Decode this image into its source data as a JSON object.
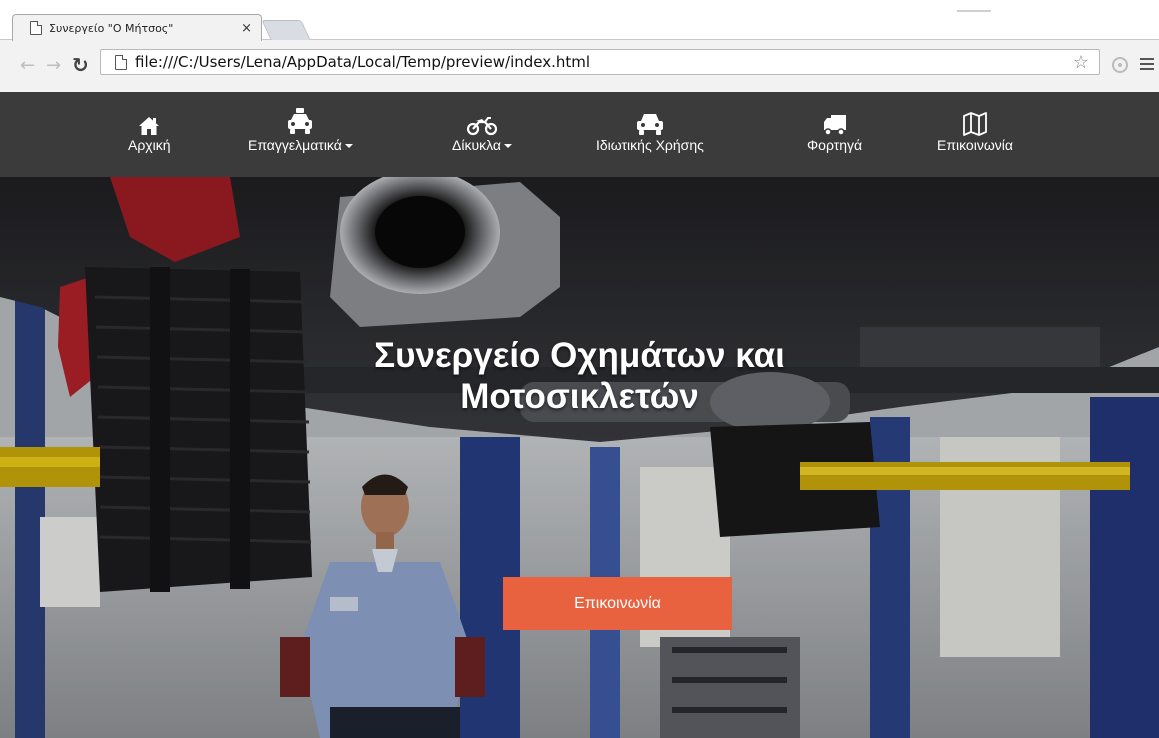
{
  "browser": {
    "tab_title": "Συνεργείο \"Ο Μήτσος\"",
    "tab_close": "×",
    "url": "file:///C:/Users/Lena/AppData/Local/Temp/preview/index.html",
    "star": "☆"
  },
  "navbar": {
    "items": [
      {
        "label": "Αρχική",
        "icon": "home-icon",
        "dropdown": false
      },
      {
        "label": "Επαγγελματικά",
        "icon": "taxi-icon",
        "dropdown": true
      },
      {
        "label": "Δίκυκλα",
        "icon": "motorcycle-icon",
        "dropdown": true
      },
      {
        "label": "Ιδιωτικής Χρήσης",
        "icon": "car-icon",
        "dropdown": false
      },
      {
        "label": "Φορτηγά",
        "icon": "truck-icon",
        "dropdown": false
      },
      {
        "label": "Επικοινωνία",
        "icon": "map-icon",
        "dropdown": false
      }
    ]
  },
  "hero": {
    "title_line1": "Συνεργείο Οχημάτων και",
    "title_line2": "Μοτοσικλετών",
    "button_label": "Επικοινωνία"
  },
  "colors": {
    "navbar_bg": "#3b3b3b",
    "button_bg": "#e8623f",
    "nav_text": "#ffffff"
  }
}
